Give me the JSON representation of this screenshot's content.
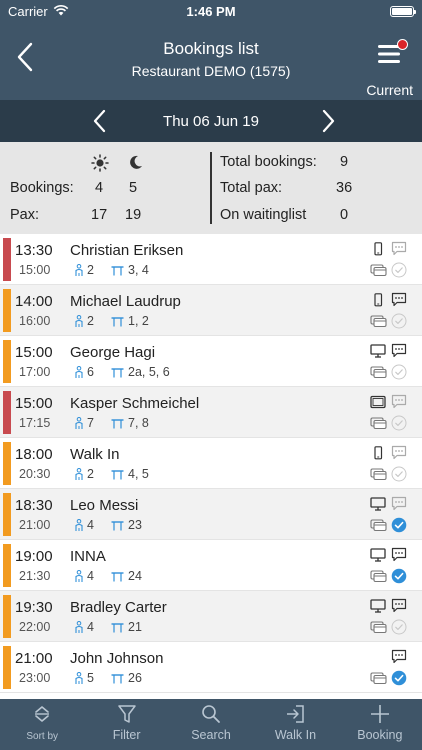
{
  "status_bar": {
    "carrier": "Carrier",
    "time": "1:46 PM"
  },
  "header": {
    "title": "Bookings list",
    "subtitle": "Restaurant DEMO (1575)",
    "menu_label": "Current"
  },
  "date_bar": {
    "date": "Thu 06 Jun 19"
  },
  "summary": {
    "bookings_label": "Bookings:",
    "pax_label": "Pax:",
    "lunch_bookings": "4",
    "dinner_bookings": "5",
    "lunch_pax": "17",
    "dinner_pax": "19",
    "total_bookings_label": "Total bookings:",
    "total_bookings": "9",
    "total_pax_label": "Total pax:",
    "total_pax": "36",
    "waitinglist_label": "On waitinglist",
    "waitinglist": "0"
  },
  "colors": {
    "header": "#3f5568",
    "datebar": "#2b3c4a",
    "red_bar": "#c84a4f",
    "orange_bar": "#f29b20",
    "check_blue": "#2f8fd8"
  },
  "bookings": [
    {
      "time": "13:30",
      "end": "15:00",
      "name": "Christian Eriksen",
      "pax": "2",
      "tables": "3, 4",
      "status": "red",
      "device": "phone-icon",
      "message": "empty",
      "checked": false
    },
    {
      "time": "14:00",
      "end": "16:00",
      "name": "Michael Laudrup",
      "pax": "2",
      "tables": "1, 2",
      "status": "orange",
      "device": "phone-icon",
      "message": "filled",
      "checked": false
    },
    {
      "time": "15:00",
      "end": "17:00",
      "name": "George Hagi",
      "pax": "6",
      "tables": "2a, 5, 6",
      "status": "orange",
      "device": "desktop-icon",
      "message": "filled",
      "checked": false
    },
    {
      "time": "15:00",
      "end": "17:15",
      "name": "Kasper Schmeichel",
      "pax": "7",
      "tables": "7, 8",
      "status": "red",
      "device": "tablet-icon",
      "message": "empty",
      "checked": false
    },
    {
      "time": "18:00",
      "end": "20:30",
      "name": "Walk In",
      "pax": "2",
      "tables": "4, 5",
      "status": "orange",
      "device": "phone-icon",
      "message": "empty",
      "checked": false
    },
    {
      "time": "18:30",
      "end": "21:00",
      "name": "Leo Messi",
      "pax": "4",
      "tables": "23",
      "status": "orange",
      "device": "desktop-icon",
      "message": "empty",
      "checked": true
    },
    {
      "time": "19:00",
      "end": "21:30",
      "name": "INNA",
      "pax": "4",
      "tables": "24",
      "status": "orange",
      "device": "desktop-icon",
      "message": "filled",
      "checked": true
    },
    {
      "time": "19:30",
      "end": "22:00",
      "name": "Bradley Carter",
      "pax": "4",
      "tables": "21",
      "status": "orange",
      "device": "desktop-icon",
      "message": "filled",
      "checked": false
    },
    {
      "time": "21:00",
      "end": "23:00",
      "name": "John Johnson",
      "pax": "5",
      "tables": "26",
      "status": "orange",
      "device": "none",
      "message": "filled",
      "checked": true
    }
  ],
  "tabs": [
    {
      "label": "Sort by",
      "icon": "sort-icon"
    },
    {
      "label": "Filter",
      "icon": "filter-icon"
    },
    {
      "label": "Search",
      "icon": "search-icon"
    },
    {
      "label": "Walk In",
      "icon": "walk-in-icon"
    },
    {
      "label": "Booking",
      "icon": "plus-icon"
    }
  ]
}
